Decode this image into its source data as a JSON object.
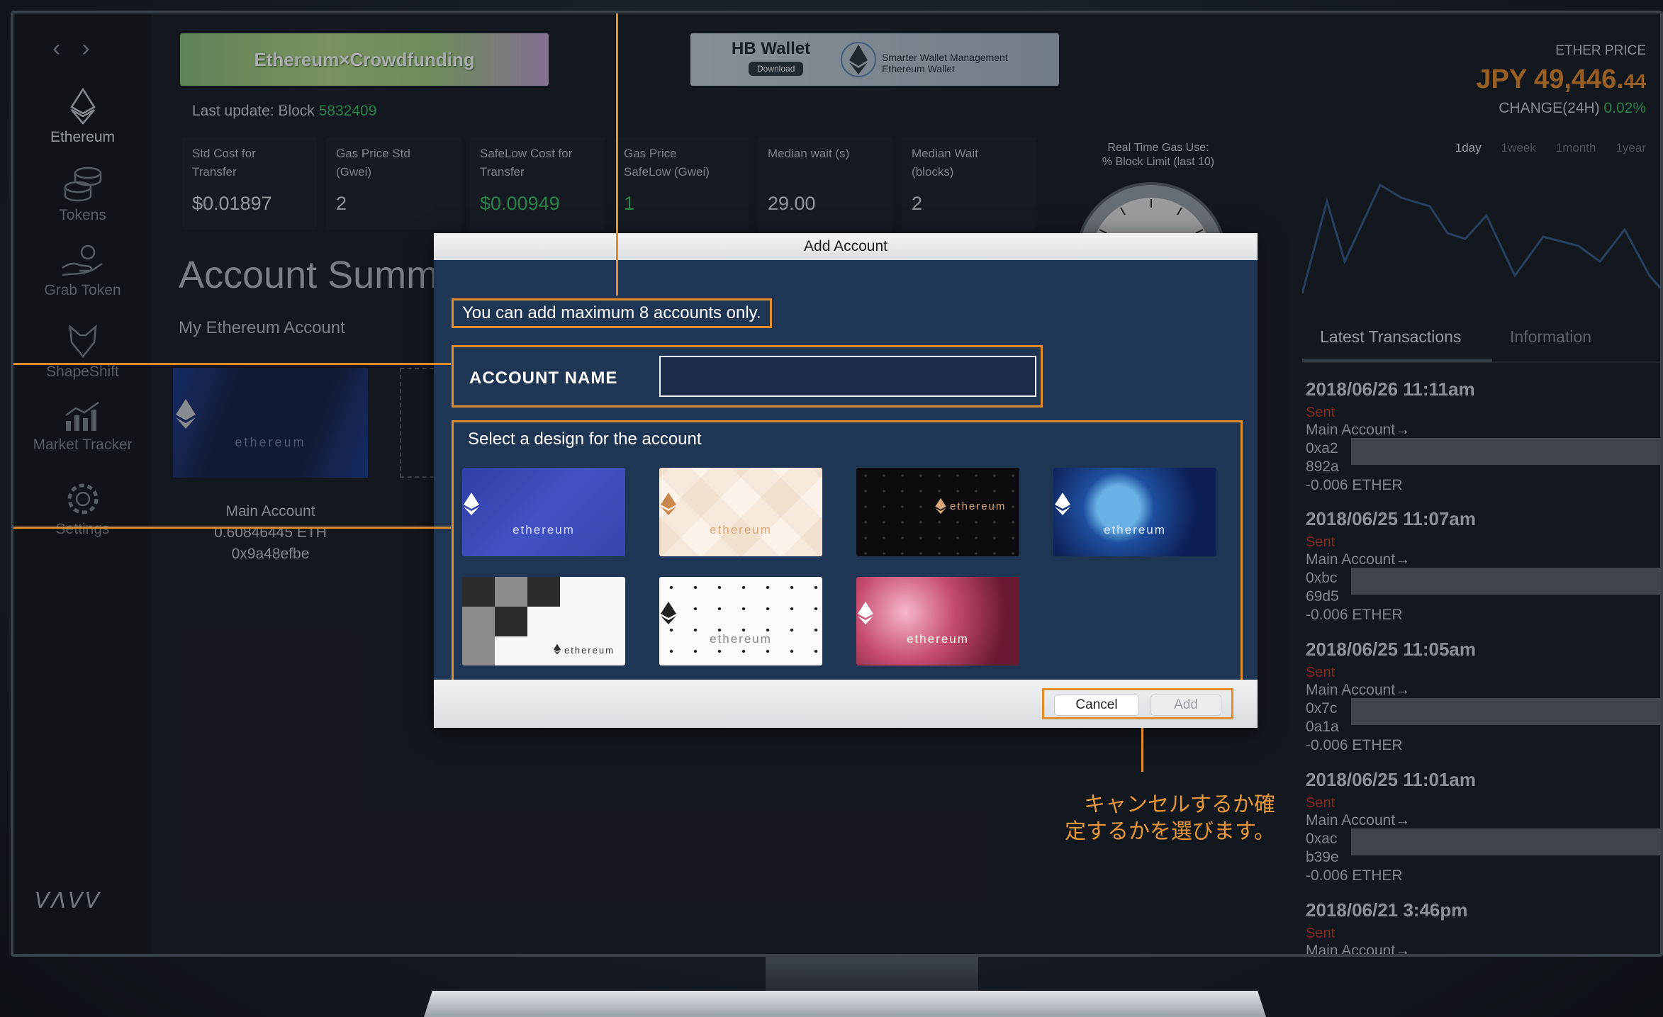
{
  "sidebar": {
    "items": [
      {
        "label": "Ethereum",
        "icon": "ethereum-icon"
      },
      {
        "label": "Tokens",
        "icon": "coins-icon"
      },
      {
        "label": "Grab Token",
        "icon": "hand-coin-icon"
      },
      {
        "label": "ShapeShift",
        "icon": "fox-icon"
      },
      {
        "label": "Market Tracker",
        "icon": "bar-chart-icon"
      },
      {
        "label": "Settings",
        "icon": "gear-icon"
      }
    ],
    "brand": "ᐯᐱᐯᐯ"
  },
  "banners": {
    "crowdfunding": "Ethereum×Crowdfunding",
    "wallet_title": "HB Wallet",
    "wallet_download": "Download",
    "wallet_sub_1": "Smarter Wallet Management",
    "wallet_sub_2": "Ethereum Wallet"
  },
  "status": {
    "last_update_label": "Last update: Block",
    "block": "5832409"
  },
  "stats": [
    {
      "label": "Std Cost for Transfer",
      "value": "$0.01897"
    },
    {
      "label": "Gas Price Std (Gwei)",
      "value": "2"
    },
    {
      "label": "SafeLow Cost for Transfer",
      "value": "$0.00949"
    },
    {
      "label": "Gas Price SafeLow (Gwei)",
      "value": "1"
    },
    {
      "label": "Median wait (s)",
      "value": "29.00"
    },
    {
      "label": "Median Wait (blocks)",
      "value": "2"
    }
  ],
  "gas": {
    "title_1": "Real Time Gas Use:",
    "title_2": "% Block Limit (last 10)"
  },
  "main": {
    "heading": "Account Summ",
    "subheading": "My Ethereum Account",
    "card_word": "ethereum",
    "account_name": "Main Account",
    "account_balance": "0.60846445 ETH",
    "account_address": "0x9a48efbe"
  },
  "price": {
    "label": "ETHER PRICE",
    "value_main": "JPY 49,446.",
    "value_decimals": "44",
    "change_label": "CHANGE(24H)",
    "change_value": "0.02%",
    "ranges": [
      "1day",
      "1week",
      "1month",
      "1year"
    ],
    "selected_range": "1day"
  },
  "tabs": {
    "latest": "Latest Transactions",
    "info": "Information"
  },
  "transactions": [
    {
      "date": "2018/06/26 11:11am",
      "status": "Sent",
      "from": "Main Account→",
      "addr1": "0xa2",
      "addr2": "892a",
      "amount": "-0.006 ETHER"
    },
    {
      "date": "2018/06/25 11:07am",
      "status": "Sent",
      "from": "Main Account→",
      "addr1": "0xbc",
      "addr2": "69d5",
      "amount": "-0.006 ETHER"
    },
    {
      "date": "2018/06/25 11:05am",
      "status": "Sent",
      "from": "Main Account→",
      "addr1": "0x7c",
      "addr2": "0a1a",
      "amount": "-0.006 ETHER"
    },
    {
      "date": "2018/06/25 11:01am",
      "status": "Sent",
      "from": "Main Account→",
      "addr1": "0xac",
      "addr2": "b39e",
      "amount": "-0.006 ETHER"
    },
    {
      "date": "2018/06/21 3:46pm",
      "status": "Sent",
      "from": "Main Account→"
    }
  ],
  "modal": {
    "title": "Add Account",
    "warning": "You can add maximum 8 accounts only.",
    "name_label": "ACCOUNT NAME",
    "name_value": "",
    "name_placeholder": "",
    "design_label": "Select a design for the account",
    "design_word": "ethereum",
    "cancel": "Cancel",
    "add": "Add"
  },
  "callout": {
    "line1": "キャンセルするか確",
    "line2": "定するかを選びます。"
  },
  "colors": {
    "accent": "#e28d2c",
    "green": "#3fbf6b",
    "sent": "#c0392b",
    "price": "#e58a2f"
  }
}
